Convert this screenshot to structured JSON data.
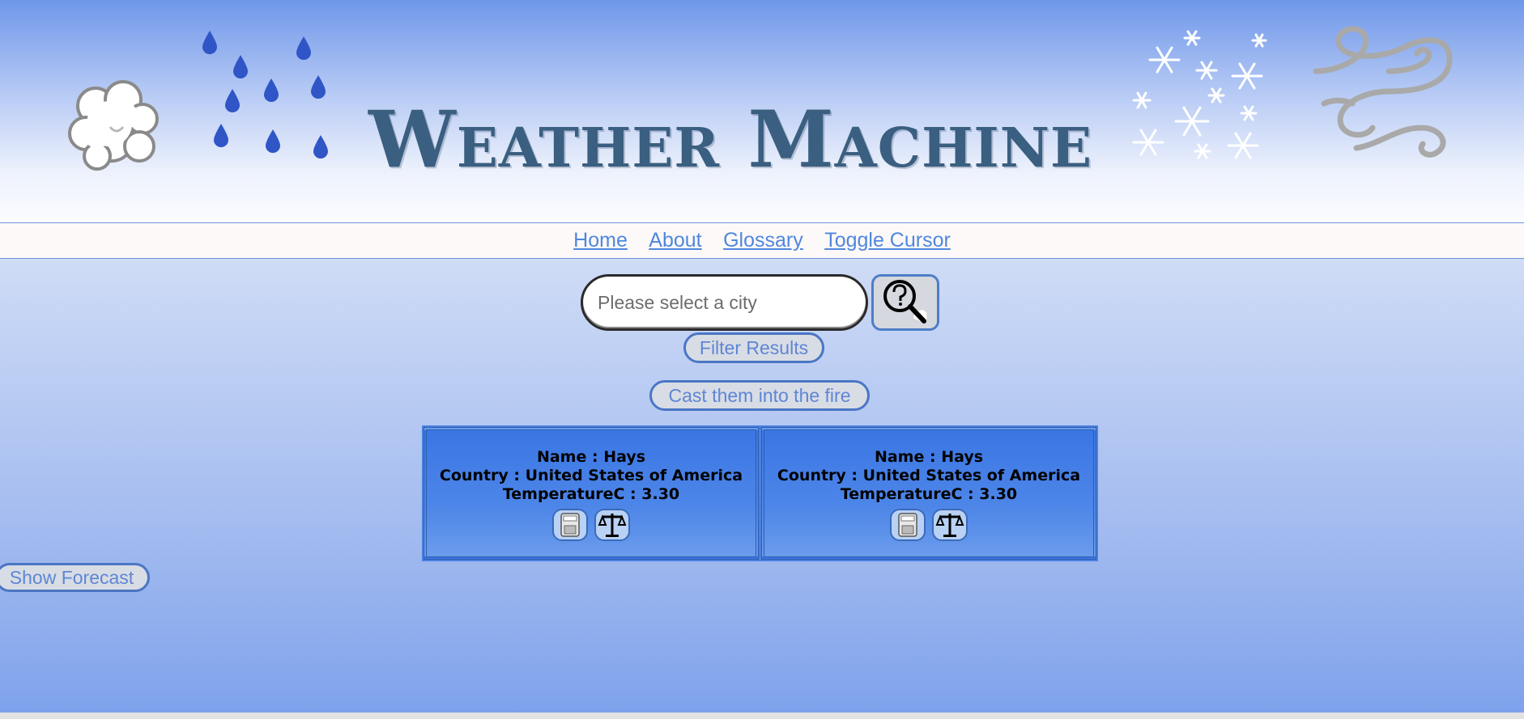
{
  "header": {
    "title": "Weather Machine",
    "icons": [
      "cloud-icon",
      "raindrops-icon",
      "snowflakes-icon",
      "wind-icon"
    ],
    "title_color": "#3a5f80"
  },
  "nav": {
    "items": [
      {
        "label": "Home"
      },
      {
        "label": "About"
      },
      {
        "label": "Glossary"
      },
      {
        "label": "Toggle Cursor"
      }
    ],
    "link_color": "#4f87de"
  },
  "search": {
    "placeholder": "Please select a city",
    "value": "",
    "button_icon": "magnifier-question-icon"
  },
  "buttons": {
    "filter_label": "Filter Results",
    "fire_label": "Cast them into the fire",
    "forecast_label": "Show Forecast"
  },
  "cards": [
    {
      "name_line": "Name : Hays",
      "country_line": "Country : United States of America",
      "temp_line": "TemperatureC : 3.30",
      "actions": [
        "toaster-icon",
        "scales-icon"
      ]
    },
    {
      "name_line": "Name : Hays",
      "country_line": "Country : United States of America",
      "temp_line": "TemperatureC : 3.30",
      "actions": [
        "toaster-icon",
        "scales-icon"
      ]
    }
  ],
  "colors": {
    "card_blue": "#3a76e4",
    "button_text": "#5e86d6"
  }
}
